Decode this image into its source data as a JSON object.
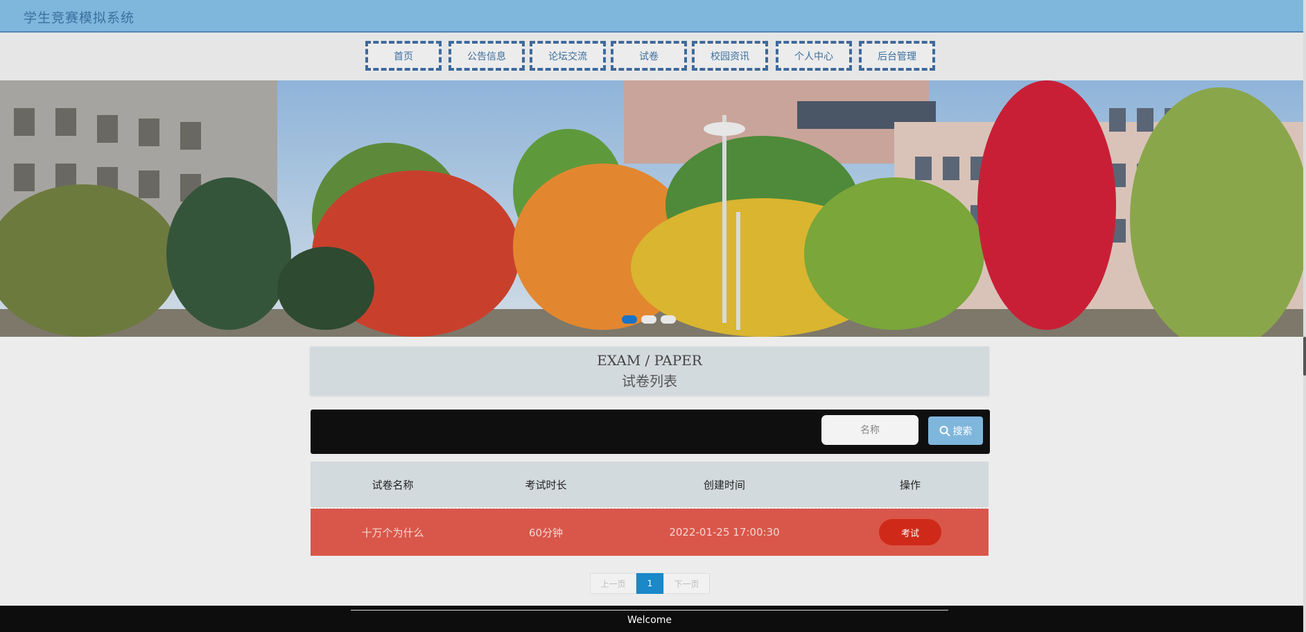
{
  "header": {
    "title": "学生竞赛模拟系统"
  },
  "nav": {
    "items": [
      {
        "label": "首页"
      },
      {
        "label": "公告信息"
      },
      {
        "label": "论坛交流"
      },
      {
        "label": "试卷"
      },
      {
        "label": "校园资讯"
      },
      {
        "label": "个人中心"
      },
      {
        "label": "后台管理"
      }
    ]
  },
  "banner": {
    "slide_count": 3,
    "active_slide": 1
  },
  "section": {
    "title_en": "EXAM / PAPER",
    "title_cn": "试卷列表"
  },
  "search": {
    "placeholder": "名称",
    "button_label": "搜索",
    "icon": "search-icon"
  },
  "table": {
    "headers": [
      "试卷名称",
      "考试时长",
      "创建时间",
      "操作"
    ],
    "rows": [
      {
        "name": "十万个为什么",
        "duration": "60分钟",
        "created": "2022-01-25 17:00:30",
        "action": "考试"
      }
    ]
  },
  "pagination": {
    "prev": "上一页",
    "current": "1",
    "next": "下一页"
  },
  "footer": {
    "text": "Welcome"
  },
  "colors": {
    "header_bg": "#7fb6dc",
    "nav_border": "#3e6a9b",
    "row_bg": "#d9574a",
    "exam_button": "#cf2a19",
    "page_active": "#1a88c9"
  }
}
